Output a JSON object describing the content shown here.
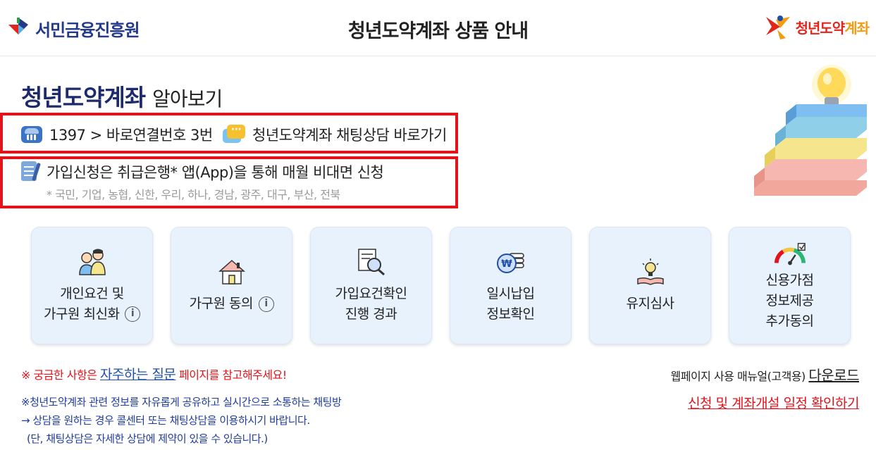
{
  "header": {
    "logo_left": "서민금융진흥원",
    "title": "청년도약계좌 상품 안내",
    "logo_right_a": "청년도약",
    "logo_right_b": "계좌"
  },
  "intro": {
    "title_main": "청년도약계좌",
    "title_sub": "알아보기"
  },
  "contact": {
    "phone_text": "1397 > 바로연결번호 3번",
    "chat_text": "청년도약계좌 채팅상담 바로가기",
    "app_text": "가입신청은 취급은행* 앱(App)을 통해 매월 비대면 신청",
    "banks_text": "* 국민, 기업, 농협, 신한, 우리, 하나, 경남, 광주, 대구, 부산, 전북"
  },
  "cards": [
    {
      "line1": "개인요건 및",
      "line2": "가구원 최신화",
      "icon": "family-icon",
      "info": "i"
    },
    {
      "line1": "가구원 동의",
      "icon": "house-icon",
      "info": "i"
    },
    {
      "line1": "가입요건확인",
      "line2": "진행 경과",
      "icon": "document-search-icon"
    },
    {
      "line1": "일시납입",
      "line2": "정보확인",
      "icon": "coin-won-icon"
    },
    {
      "line1": "유지심사",
      "icon": "lightbulb-book-icon"
    },
    {
      "line1": "신용가점",
      "line2": "정보제공",
      "line3": "추가동의",
      "icon": "credit-gauge-icon"
    }
  ],
  "footer": {
    "faq_prefix": "※ 궁금한 사항은 ",
    "faq_link": "자주하는 질문",
    "faq_suffix": " 페이지를 참고해주세요!",
    "notice_line1": "※청년도약계좌 관련 정보를 자유롭게 공유하고 실시간으로 소통하는 채팅방",
    "notice_line2": "→ 상담을 원하는 경우 콜센터 또는 채팅상담을 이용하시기 바랍니다.",
    "notice_line3": "(단, 채팅상담은 자세한 상담에 제약이 있을 수 있습니다.)",
    "manual_prefix": "웹페이지 사용 매뉴얼(고객용) ",
    "manual_link": "다운로드",
    "schedule_link": "신청 및 계좌개설 일정 확인하기"
  },
  "colors": {
    "accent_red": "#e3131b",
    "navy": "#1d2a6b",
    "card_bg": "#e8f2fd",
    "link_blue": "#1f4fa8"
  }
}
